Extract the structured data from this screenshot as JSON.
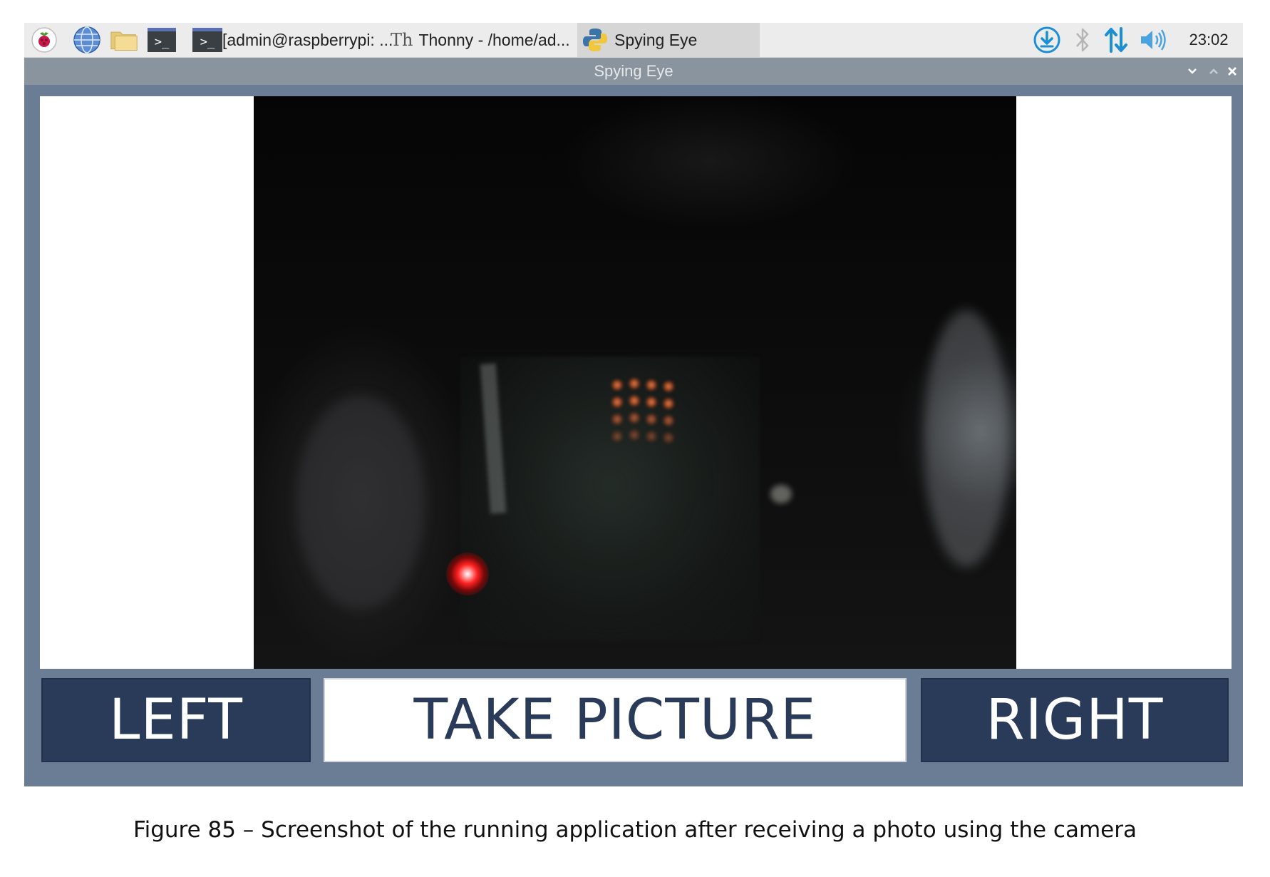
{
  "taskbar": {
    "menu_icon": "raspberry-pi-icon",
    "launchers": [
      "globe-icon",
      "file-manager-icon",
      "terminal-icon"
    ],
    "tasks": [
      {
        "label": "[admin@raspberrypi: ...",
        "icon": "terminal-icon"
      },
      {
        "label": "Thonny  -  /home/ad...",
        "icon": "thonny-icon"
      },
      {
        "label": "Spying Eye",
        "icon": "python-icon",
        "active": true
      }
    ],
    "tray_icons": [
      "download-icon",
      "bluetooth-icon",
      "network-icon",
      "volume-icon"
    ],
    "clock": "23:02"
  },
  "window": {
    "title": "Spying Eye",
    "controls": [
      "minimize",
      "maximize",
      "close"
    ]
  },
  "app": {
    "preview_description": "camera-photo",
    "buttons": {
      "left": "LEFT",
      "take_picture": "TAKE PICTURE",
      "right": "RIGHT"
    }
  },
  "caption": "Figure 85 – Screenshot of the running application after receiving a photo using the camera",
  "colors": {
    "button_dark": "#2a3b59",
    "window_frame": "#6b7d94",
    "title_bar": "#8a949e",
    "taskbar": "#ececec"
  }
}
